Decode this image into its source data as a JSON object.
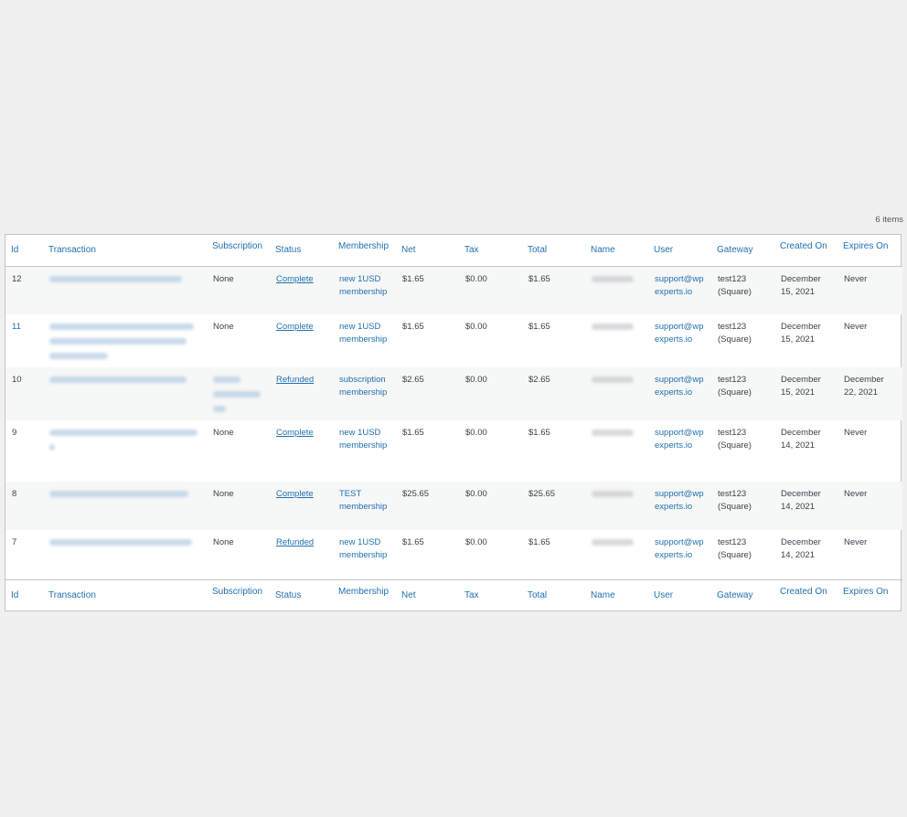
{
  "table": {
    "item_count": "6 items",
    "columns": [
      "Id",
      "Transaction",
      "Subscription",
      "Status",
      "Membership",
      "Net",
      "Tax",
      "Total",
      "Name",
      "User",
      "Gateway",
      "Created On",
      "Expires On"
    ],
    "rows": [
      {
        "id": "12",
        "subscription": "None",
        "status": "Complete",
        "membership": [
          "new 1USD",
          "membership"
        ],
        "net": "$1.65",
        "tax": "$0.00",
        "total": "$1.65",
        "user": [
          "support@wp",
          "experts.io"
        ],
        "gateway": [
          "test123",
          "(Square)"
        ],
        "created": [
          "December",
          "15, 2021"
        ],
        "expires": [
          "Never",
          ""
        ]
      },
      {
        "id": "11",
        "subscription": "None",
        "status": "Complete",
        "membership": [
          "new 1USD",
          "membership"
        ],
        "net": "$1.65",
        "tax": "$0.00",
        "total": "$1.65",
        "user": [
          "support@wp",
          "experts.io"
        ],
        "gateway": [
          "test123",
          "(Square)"
        ],
        "created": [
          "December",
          "15, 2021"
        ],
        "expires": [
          "Never",
          ""
        ]
      },
      {
        "id": "10",
        "subscription": "",
        "status": "Refunded",
        "membership": [
          "subscription",
          "membership"
        ],
        "net": "$2.65",
        "tax": "$0.00",
        "total": "$2.65",
        "user": [
          "support@wp",
          "experts.io"
        ],
        "gateway": [
          "test123",
          "(Square)"
        ],
        "created": [
          "December",
          "15, 2021"
        ],
        "expires": [
          "December",
          "22, 2021"
        ]
      },
      {
        "id": "9",
        "subscription": "None",
        "status": "Complete",
        "membership": [
          "new 1USD",
          "membership"
        ],
        "net": "$1.65",
        "tax": "$0.00",
        "total": "$1.65",
        "user": [
          "support@wp",
          "experts.io"
        ],
        "gateway": [
          "test123",
          "(Square)"
        ],
        "created": [
          "December",
          "14, 2021"
        ],
        "expires": [
          "Never",
          ""
        ]
      },
      {
        "id": "8",
        "subscription": "None",
        "status": "Complete",
        "membership": [
          "TEST",
          "membership"
        ],
        "net": "$25.65",
        "tax": "$0.00",
        "total": "$25.65",
        "user": [
          "support@wp",
          "experts.io"
        ],
        "gateway": [
          "test123",
          "(Square)"
        ],
        "created": [
          "December",
          "14, 2021"
        ],
        "expires": [
          "Never",
          ""
        ]
      },
      {
        "id": "7",
        "subscription": "None",
        "status": "Refunded",
        "membership": [
          "new 1USD",
          "membership"
        ],
        "net": "$1.65",
        "tax": "$0.00",
        "total": "$1.65",
        "user": [
          "support@wp",
          "experts.io"
        ],
        "gateway": [
          "test123",
          "(Square)"
        ],
        "created": [
          "December",
          "14, 2021"
        ],
        "expires": [
          "Never",
          ""
        ]
      }
    ]
  }
}
